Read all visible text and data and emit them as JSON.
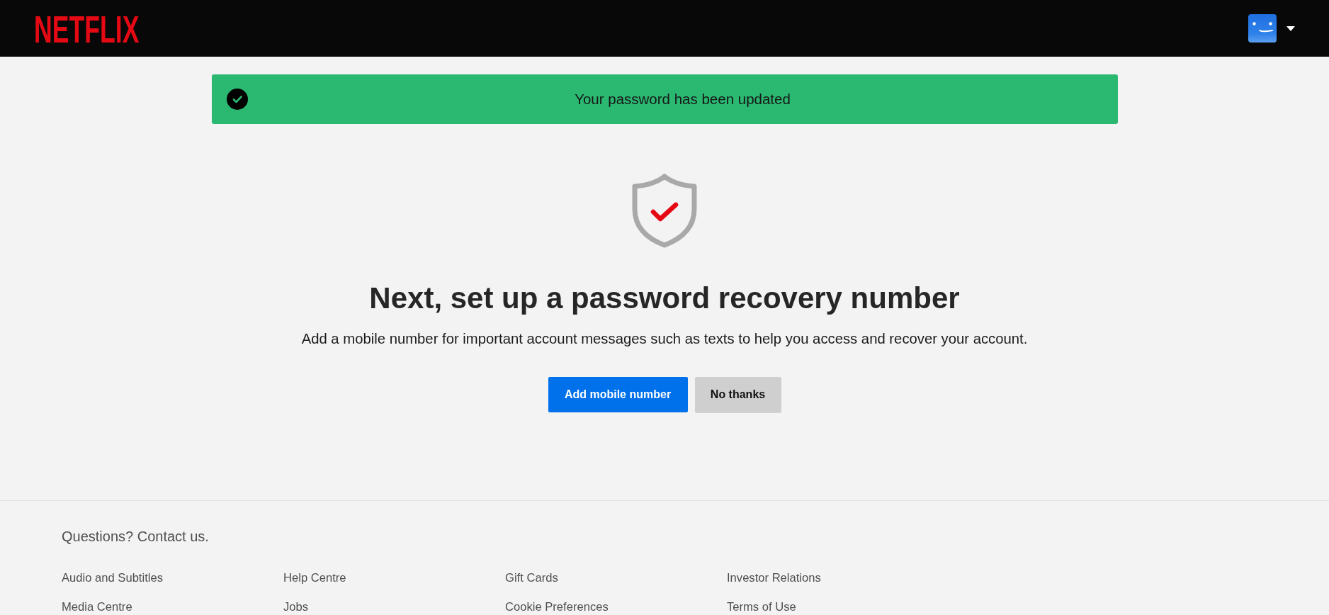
{
  "header": {
    "logo": "NETFLIX"
  },
  "banner": {
    "kind": "success",
    "message": "Your password has been updated"
  },
  "main": {
    "heading": "Next, set up a password recovery number",
    "description": "Add a mobile number for important account messages such as texts to help you access and recover your account.",
    "buttons": [
      {
        "label": "Add mobile number",
        "kind": "primary"
      },
      {
        "label": "No thanks",
        "kind": "secondary"
      }
    ]
  },
  "footer": {
    "contact": "Questions? Contact us.",
    "links": [
      "Audio and Subtitles",
      "Help Centre",
      "Gift Cards",
      "Investor Relations",
      "Media Centre",
      "Jobs",
      "Cookie Preferences",
      "Terms of Use"
    ]
  }
}
